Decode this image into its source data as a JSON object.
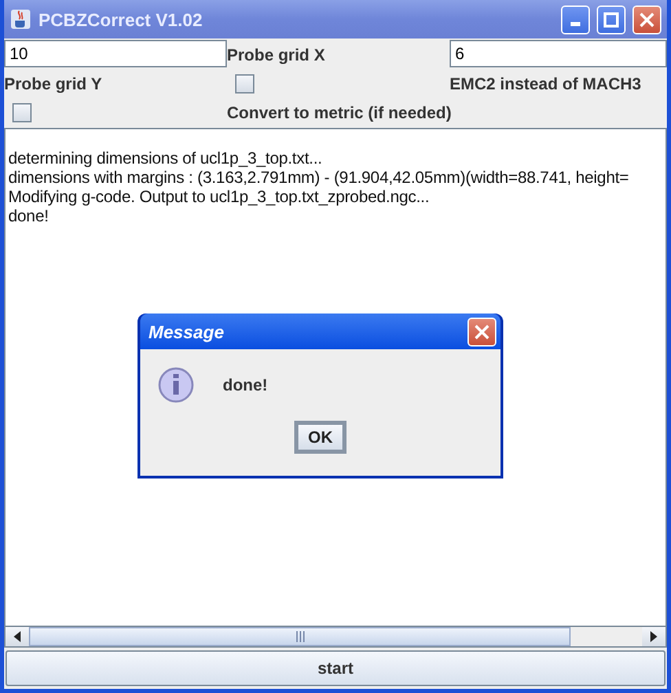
{
  "window": {
    "title": "PCBZCorrect V1.02"
  },
  "form": [
    {
      "kind": "field",
      "value": "10"
    },
    {
      "kind": "label",
      "text": "Probe grid X"
    },
    {
      "kind": "field",
      "value": "6"
    },
    {
      "kind": "label",
      "text": "Probe grid Y"
    },
    {
      "kind": "checkbox",
      "checked": false
    },
    {
      "kind": "label",
      "text": "EMC2 instead of MACH3"
    },
    {
      "kind": "checkbox",
      "checked": false
    },
    {
      "kind": "label",
      "text": "Convert to metric (if needed)"
    }
  ],
  "log": [
    "determining dimensions of ucl1p_3_top.txt...",
    "dimensions with  margins : (3.163,2.791mm) - (91.904,42.05mm)(width=88.741, height=",
    "Modifying g-code. Output to ucl1p_3_top.txt_zprobed.ngc...",
    "done!"
  ],
  "start_button": "start",
  "dialog": {
    "title": "Message",
    "message": "done!",
    "button": "OK"
  }
}
